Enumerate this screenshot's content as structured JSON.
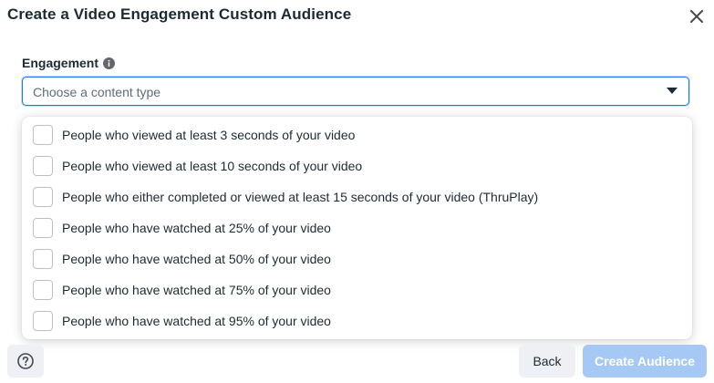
{
  "dialog": {
    "title": "Create a Video Engagement Custom Audience",
    "close_icon": "close-icon"
  },
  "engagement": {
    "label": "Engagement",
    "info_icon": "info-icon",
    "select": {
      "placeholder": "Choose a content type",
      "caret_icon": "caret-down-icon"
    }
  },
  "options": [
    {
      "label": "People who viewed at least 3 seconds of your video",
      "checked": false
    },
    {
      "label": "People who viewed at least 10 seconds of your video",
      "checked": false
    },
    {
      "label": "People who either completed or viewed at least 15 seconds of your video (ThruPlay)",
      "checked": false
    },
    {
      "label": "People who have watched at 25% of your video",
      "checked": false
    },
    {
      "label": "People who have watched at 50% of your video",
      "checked": false
    },
    {
      "label": "People who have watched at 75% of your video",
      "checked": false
    },
    {
      "label": "People who have watched at 95% of your video",
      "checked": false
    }
  ],
  "footer": {
    "help_icon": "help-icon",
    "back_label": "Back",
    "create_label": "Create Audience"
  },
  "colors": {
    "accent": "#1877f2",
    "primary_disabled": "#a6c8f5",
    "secondary_button": "#eef0f3",
    "text": "#1c2b33"
  }
}
